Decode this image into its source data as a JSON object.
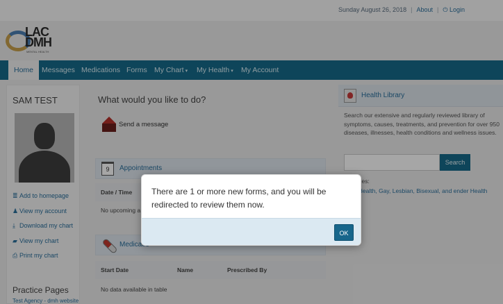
{
  "topbar": {
    "date": "Sunday August 26, 2018",
    "about": "About",
    "login": "Login"
  },
  "logo": {
    "line1": "LAC",
    "line2": "DMH",
    "sub": "MENTAL HEALTH"
  },
  "nav": {
    "items": [
      {
        "label": "Home",
        "active": true
      },
      {
        "label": "Messages"
      },
      {
        "label": "Medications"
      },
      {
        "label": "Forms"
      },
      {
        "label": "My Chart",
        "caret": "▾"
      },
      {
        "label": "My Health",
        "caret": "▾"
      },
      {
        "label": "My Account"
      }
    ]
  },
  "sidebar": {
    "name": "SAM TEST",
    "links": [
      {
        "icon": "list-icon",
        "glyph": "≣",
        "label": "Add to homepage"
      },
      {
        "icon": "user-icon",
        "glyph": "♟",
        "label": "View my account"
      },
      {
        "icon": "download-icon",
        "glyph": "⤓",
        "label": "Download my chart"
      },
      {
        "icon": "folder-icon",
        "glyph": "▰",
        "label": "View my chart"
      },
      {
        "icon": "print-icon",
        "glyph": "⎙",
        "label": "Print my chart"
      }
    ],
    "practice_title": "Practice Pages",
    "practice_sub": "Test Agency - dmh website"
  },
  "center": {
    "question": "What would you like to do?",
    "send_message": "Send a message",
    "appointments": {
      "title": "Appointments",
      "cal_day": "9",
      "columns": [
        "Date / Time"
      ],
      "empty": "No upcoming a"
    },
    "medications": {
      "title": "Medicatio",
      "columns": [
        "Start Date",
        "Name",
        "Prescribed By"
      ],
      "empty": "No data available in table"
    }
  },
  "health_library": {
    "title": "Health Library",
    "description": "Search our extensive and regularly reviewed library of symptoms, causes, treatments, and prevention for over 950 diseases, illnesses, health conditions and wellness issues.",
    "search_placeholder": "",
    "search_button": "Search",
    "common_label": "searches:",
    "tags": "ental Health, Gay, Lesbian, Bisexual, and ender Health"
  },
  "modal": {
    "message": "There are 1 or more new forms, and you will be redirected to review them now.",
    "ok": "OK"
  },
  "colors": {
    "nav": "#166a8a",
    "link": "#2a6f9c",
    "modal_footer": "#dbe9f2",
    "button": "#17668b"
  }
}
